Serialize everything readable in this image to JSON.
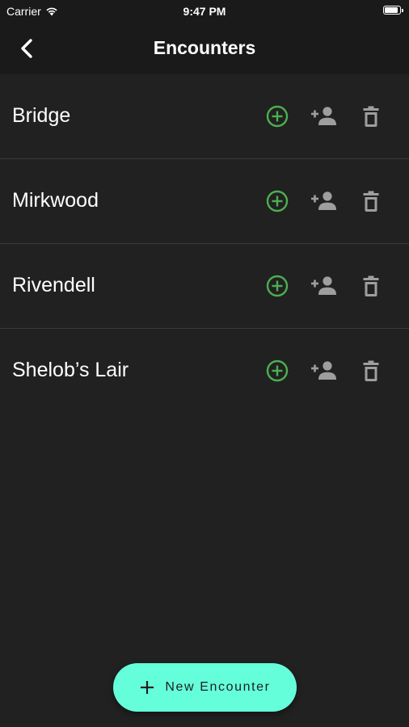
{
  "status_bar": {
    "carrier": "Carrier",
    "time": "9:47 PM",
    "battery_level": 1.0
  },
  "header": {
    "title": "Encounters",
    "back_icon": "chevron-left-icon"
  },
  "encounters": [
    {
      "name": "Bridge"
    },
    {
      "name": "Mirkwood"
    },
    {
      "name": "Rivendell"
    },
    {
      "name": "Shelob’s Lair"
    }
  ],
  "row_actions": {
    "add_icon": "add-circle-icon",
    "add_person_icon": "person-add-icon",
    "delete_icon": "trash-icon"
  },
  "fab": {
    "label": "New Encounter",
    "icon": "plus-icon"
  },
  "colors": {
    "background": "#212121",
    "app_bar": "#1a1a1a",
    "accent_green": "#4caf50",
    "icon_grey": "#9e9e9e",
    "fab": "#64ffda",
    "divider": "#3a3a3a"
  }
}
